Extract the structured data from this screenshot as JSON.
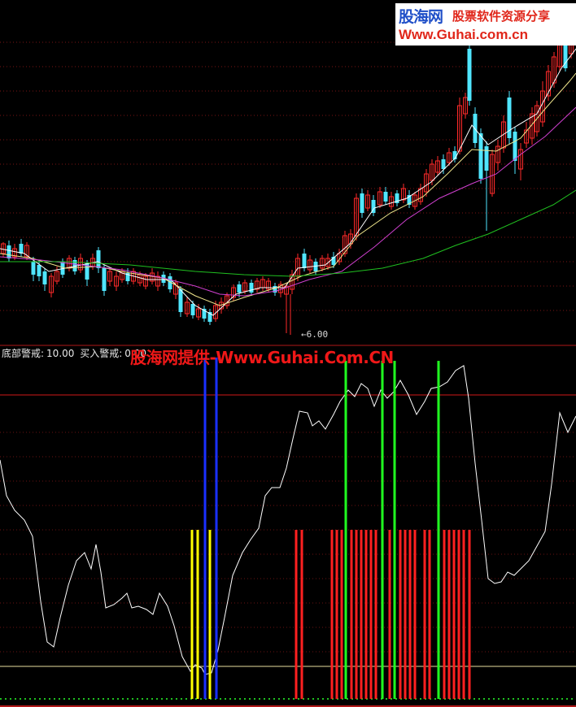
{
  "watermark_top": {
    "cn": "股海网",
    "tagline": "股票软件资源分享",
    "url": "Www.Guhai.com.cn"
  },
  "price_panel": {
    "low_label": "6.00"
  },
  "indicator_panel": {
    "bottom_warning_label": "底部警戒:",
    "bottom_warning_value": "10.00",
    "buy_warning_label": "买入警戒:",
    "buy_warning_value": "0.00"
  },
  "watermark_mid": "股海网提供-Www.Guhai.Com.CN",
  "colors": {
    "up": "#ff2a2a",
    "down": "#50e6ff",
    "ma5": "#ffffff",
    "ma10": "#f0e68c",
    "ma20": "#d040d0",
    "ma60": "#20c020",
    "osc": "#ffffff",
    "yellow_bar": "#ffff00",
    "blue_bar": "#1a30ff",
    "green_bar": "#20ff20",
    "red_bar": "#ff2020"
  }
}
